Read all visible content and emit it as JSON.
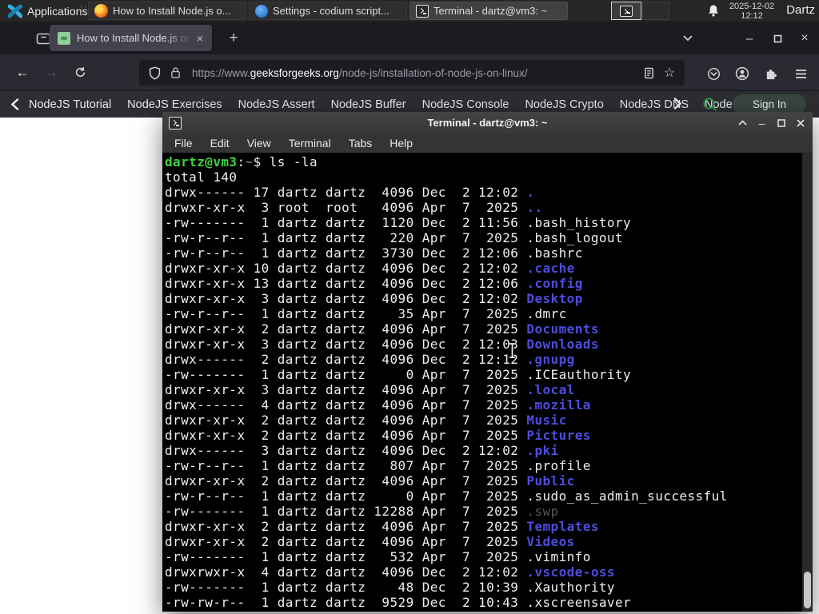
{
  "taskbar": {
    "applications_label": "Applications",
    "windows": [
      {
        "title": "How to Install Node.js o...",
        "app": "firefox"
      },
      {
        "title": "Settings - codium script...",
        "app": "vscodium"
      },
      {
        "title": "Terminal - dartz@vm3: ~",
        "app": "terminal",
        "active": true
      }
    ],
    "clock": {
      "date": "2025-12-02",
      "time": "12:12"
    },
    "user_label": "Dartz"
  },
  "browser": {
    "tab_title": "How to Install Node.js on",
    "tab_close_glyph": "×",
    "new_tab_glyph": "+",
    "back_glyph": "←",
    "forward_glyph": "→",
    "bookmark_star_glyph": "☆",
    "window_minimize_glyph": "–",
    "window_close_glyph": "×",
    "url": {
      "scheme": "https://www.",
      "domain": "geeksforgeeks.org",
      "path": "/node-js/installation-of-node-js-on-linux/"
    }
  },
  "site_nav": {
    "items": [
      "NodeJS Tutorial",
      "NodeJS Exercises",
      "NodeJS Assert",
      "NodeJS Buffer",
      "NodeJS Console",
      "NodeJS Crypto",
      "NodeJS DNS",
      "Node"
    ],
    "sign_in_label": "Sign In"
  },
  "terminal": {
    "window_title": "Terminal - dartz@vm3: ~",
    "minimize_glyph": "–",
    "menu": [
      "File",
      "Edit",
      "View",
      "Terminal",
      "Tabs",
      "Help"
    ],
    "prompt": {
      "user_host": "dartz@vm3",
      "separator": ":",
      "cwd": "~",
      "symbol": "$ ",
      "command": "ls -la"
    },
    "total_line": "total 140",
    "listing": [
      {
        "perms": "drwx------",
        "links": "17",
        "owner": "dartz",
        "group": "dartz",
        "size": "4096",
        "month": "Dec",
        "day": "2",
        "time": "12:02",
        "name": ".",
        "type": "dir"
      },
      {
        "perms": "drwxr-xr-x",
        "links": "3",
        "owner": "root",
        "group": "root",
        "size": "4096",
        "month": "Apr",
        "day": "7",
        "time": "2025",
        "name": "..",
        "type": "dir"
      },
      {
        "perms": "-rw-------",
        "links": "1",
        "owner": "dartz",
        "group": "dartz",
        "size": "1120",
        "month": "Dec",
        "day": "2",
        "time": "11:56",
        "name": ".bash_history",
        "type": "file"
      },
      {
        "perms": "-rw-r--r--",
        "links": "1",
        "owner": "dartz",
        "group": "dartz",
        "size": "220",
        "month": "Apr",
        "day": "7",
        "time": "2025",
        "name": ".bash_logout",
        "type": "file"
      },
      {
        "perms": "-rw-r--r--",
        "links": "1",
        "owner": "dartz",
        "group": "dartz",
        "size": "3730",
        "month": "Dec",
        "day": "2",
        "time": "12:06",
        "name": ".bashrc",
        "type": "file"
      },
      {
        "perms": "drwxr-xr-x",
        "links": "10",
        "owner": "dartz",
        "group": "dartz",
        "size": "4096",
        "month": "Dec",
        "day": "2",
        "time": "12:02",
        "name": ".cache",
        "type": "dir"
      },
      {
        "perms": "drwxr-xr-x",
        "links": "13",
        "owner": "dartz",
        "group": "dartz",
        "size": "4096",
        "month": "Dec",
        "day": "2",
        "time": "12:06",
        "name": ".config",
        "type": "dir"
      },
      {
        "perms": "drwxr-xr-x",
        "links": "3",
        "owner": "dartz",
        "group": "dartz",
        "size": "4096",
        "month": "Dec",
        "day": "2",
        "time": "12:02",
        "name": "Desktop",
        "type": "dir"
      },
      {
        "perms": "-rw-r--r--",
        "links": "1",
        "owner": "dartz",
        "group": "dartz",
        "size": "35",
        "month": "Apr",
        "day": "7",
        "time": "2025",
        "name": ".dmrc",
        "type": "file"
      },
      {
        "perms": "drwxr-xr-x",
        "links": "2",
        "owner": "dartz",
        "group": "dartz",
        "size": "4096",
        "month": "Apr",
        "day": "7",
        "time": "2025",
        "name": "Documents",
        "type": "dir"
      },
      {
        "perms": "drwxr-xr-x",
        "links": "3",
        "owner": "dartz",
        "group": "dartz",
        "size": "4096",
        "month": "Dec",
        "day": "2",
        "time": "12:03",
        "name": "Downloads",
        "type": "dir"
      },
      {
        "perms": "drwx------",
        "links": "2",
        "owner": "dartz",
        "group": "dartz",
        "size": "4096",
        "month": "Dec",
        "day": "2",
        "time": "12:12",
        "name": ".gnupg",
        "type": "dir"
      },
      {
        "perms": "-rw-------",
        "links": "1",
        "owner": "dartz",
        "group": "dartz",
        "size": "0",
        "month": "Apr",
        "day": "7",
        "time": "2025",
        "name": ".ICEauthority",
        "type": "file"
      },
      {
        "perms": "drwxr-xr-x",
        "links": "3",
        "owner": "dartz",
        "group": "dartz",
        "size": "4096",
        "month": "Apr",
        "day": "7",
        "time": "2025",
        "name": ".local",
        "type": "dir"
      },
      {
        "perms": "drwx------",
        "links": "4",
        "owner": "dartz",
        "group": "dartz",
        "size": "4096",
        "month": "Apr",
        "day": "7",
        "time": "2025",
        "name": ".mozilla",
        "type": "dir"
      },
      {
        "perms": "drwxr-xr-x",
        "links": "2",
        "owner": "dartz",
        "group": "dartz",
        "size": "4096",
        "month": "Apr",
        "day": "7",
        "time": "2025",
        "name": "Music",
        "type": "dir"
      },
      {
        "perms": "drwxr-xr-x",
        "links": "2",
        "owner": "dartz",
        "group": "dartz",
        "size": "4096",
        "month": "Apr",
        "day": "7",
        "time": "2025",
        "name": "Pictures",
        "type": "dir"
      },
      {
        "perms": "drwx------",
        "links": "3",
        "owner": "dartz",
        "group": "dartz",
        "size": "4096",
        "month": "Dec",
        "day": "2",
        "time": "12:02",
        "name": ".pki",
        "type": "dir"
      },
      {
        "perms": "-rw-r--r--",
        "links": "1",
        "owner": "dartz",
        "group": "dartz",
        "size": "807",
        "month": "Apr",
        "day": "7",
        "time": "2025",
        "name": ".profile",
        "type": "file"
      },
      {
        "perms": "drwxr-xr-x",
        "links": "2",
        "owner": "dartz",
        "group": "dartz",
        "size": "4096",
        "month": "Apr",
        "day": "7",
        "time": "2025",
        "name": "Public",
        "type": "dir"
      },
      {
        "perms": "-rw-r--r--",
        "links": "1",
        "owner": "dartz",
        "group": "dartz",
        "size": "0",
        "month": "Apr",
        "day": "7",
        "time": "2025",
        "name": ".sudo_as_admin_successful",
        "type": "file"
      },
      {
        "perms": "-rw-------",
        "links": "1",
        "owner": "dartz",
        "group": "dartz",
        "size": "12288",
        "month": "Apr",
        "day": "7",
        "time": "2025",
        "name": ".swp",
        "type": "dim"
      },
      {
        "perms": "drwxr-xr-x",
        "links": "2",
        "owner": "dartz",
        "group": "dartz",
        "size": "4096",
        "month": "Apr",
        "day": "7",
        "time": "2025",
        "name": "Templates",
        "type": "dir"
      },
      {
        "perms": "drwxr-xr-x",
        "links": "2",
        "owner": "dartz",
        "group": "dartz",
        "size": "4096",
        "month": "Apr",
        "day": "7",
        "time": "2025",
        "name": "Videos",
        "type": "dir"
      },
      {
        "perms": "-rw-------",
        "links": "1",
        "owner": "dartz",
        "group": "dartz",
        "size": "532",
        "month": "Apr",
        "day": "7",
        "time": "2025",
        "name": ".viminfo",
        "type": "file"
      },
      {
        "perms": "drwxrwxr-x",
        "links": "4",
        "owner": "dartz",
        "group": "dartz",
        "size": "4096",
        "month": "Dec",
        "day": "2",
        "time": "12:02",
        "name": ".vscode-oss",
        "type": "dir"
      },
      {
        "perms": "-rw-------",
        "links": "1",
        "owner": "dartz",
        "group": "dartz",
        "size": "48",
        "month": "Dec",
        "day": "2",
        "time": "10:39",
        "name": ".Xauthority",
        "type": "file"
      },
      {
        "perms": "-rw-rw-r--",
        "links": "1",
        "owner": "dartz",
        "group": "dartz",
        "size": "9529",
        "month": "Dec",
        "day": "2",
        "time": "10:43",
        "name": ".xscreensaver",
        "type": "file"
      }
    ]
  },
  "colors": {
    "prompt_green": "#3ed43e",
    "directory_blue": "#4d4ddd",
    "terminal_fg": "#eeeeee",
    "dim_file_gray": "#565656",
    "gfg_green": "#2f8d46",
    "active_tab_bg": "#42414d",
    "panel_bg": "#262626"
  }
}
